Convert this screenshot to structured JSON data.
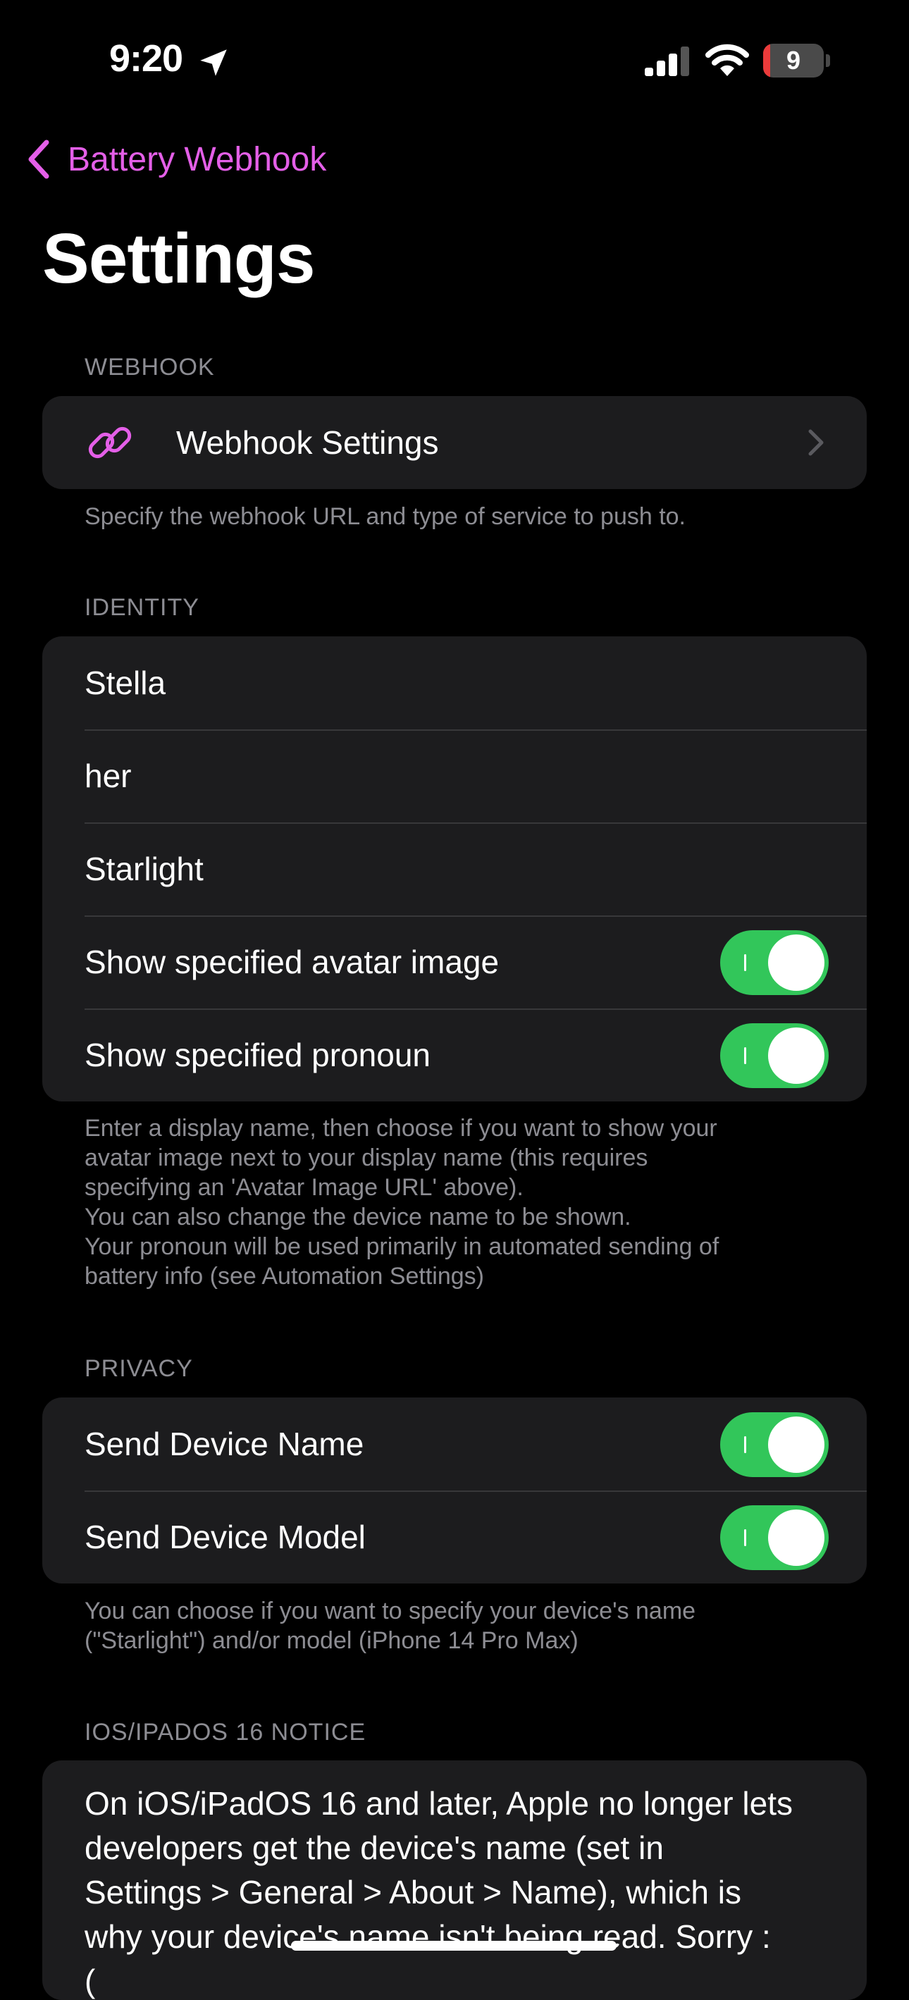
{
  "status_bar": {
    "time": "9:20",
    "battery_level": "9"
  },
  "nav": {
    "back_label": "Battery Webhook",
    "title": "Settings"
  },
  "webhook": {
    "header": "WEBHOOK",
    "item_label": "Webhook Settings",
    "footer": "Specify the webhook URL and type of service to push to."
  },
  "identity": {
    "header": "IDENTITY",
    "display_name": "Stella",
    "pronoun": "her",
    "device_name": "Starlight",
    "show_avatar_label": "Show specified avatar image",
    "show_avatar_on": true,
    "show_pronoun_label": "Show specified pronoun",
    "show_pronoun_on": true,
    "footer_lines": [
      "Enter a display name, then choose if you want to show your",
      "avatar image next to your display name (this requires",
      "specifying an 'Avatar Image URL' above).",
      "You can also change the device name to be shown.",
      "Your pronoun will be used primarily in automated sending of",
      "battery info (see Automation Settings)"
    ]
  },
  "privacy": {
    "header": "PRIVACY",
    "send_name_label": "Send Device Name",
    "send_name_on": true,
    "send_model_label": "Send Device Model",
    "send_model_on": true,
    "footer_lines": [
      "You can choose if you want to specify your device's name",
      "(\"Starlight\") and/or model (iPhone 14 Pro Max)"
    ]
  },
  "notice": {
    "header": "IOS/IPADOS 16 NOTICE",
    "lines": [
      "On iOS/iPadOS 16 and later, Apple no longer lets",
      "developers get the device's name (set in",
      "Settings > General > About > Name), which is",
      "why your device's name isn't being read. Sorry :",
      "("
    ]
  },
  "colors": {
    "accent": "#e45fe8",
    "toggle_on": "#32c65a",
    "card": "#1c1c1e",
    "secondary_text": "#8d8d93"
  }
}
